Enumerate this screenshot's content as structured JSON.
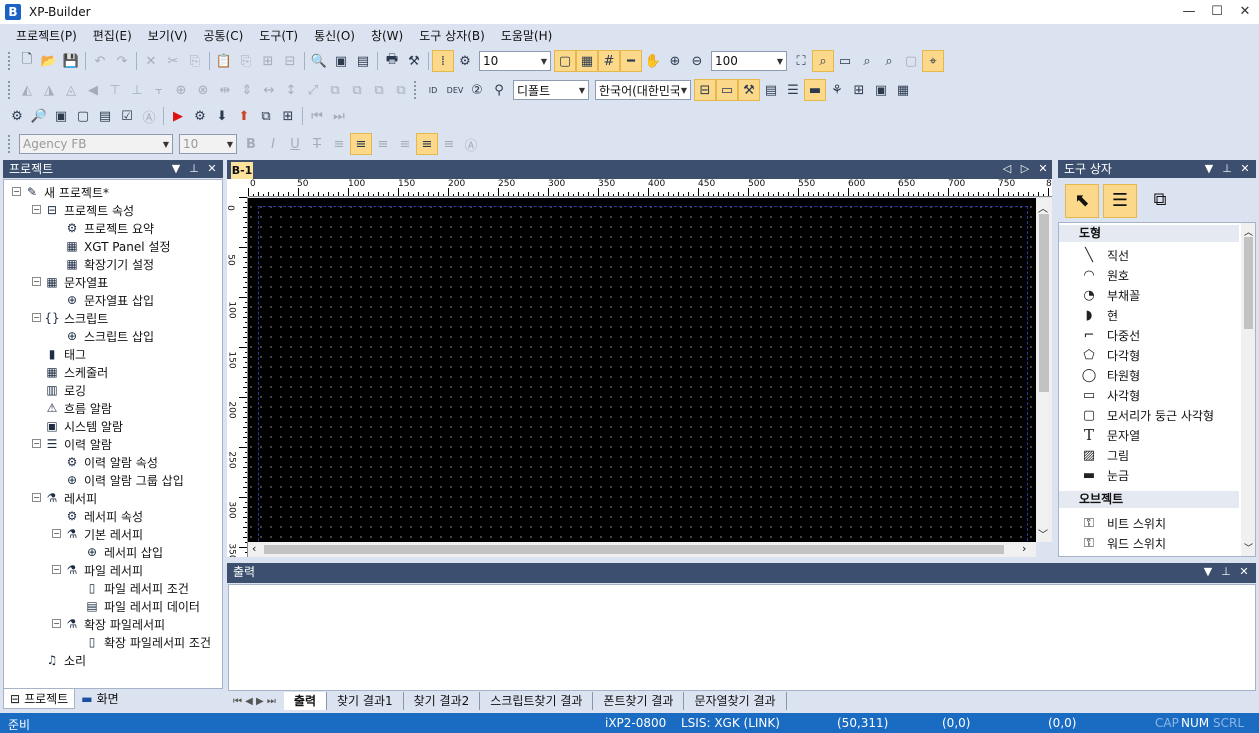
{
  "app": {
    "title": "XP-Builder",
    "logo_letter": "B"
  },
  "window": {
    "min": "—",
    "max": "☐",
    "close": "✕"
  },
  "menu": [
    "프로젝트(P)",
    "편집(E)",
    "보기(V)",
    "공통(C)",
    "도구(T)",
    "통신(O)",
    "창(W)",
    "도구 상자(B)",
    "도움말(H)"
  ],
  "toolbar": {
    "grid_size": "10",
    "zoom": "100",
    "font_name": "Agency FB",
    "font_size": "10",
    "default_combo": "디폴트",
    "language": "한국어(대한민국"
  },
  "project_panel": {
    "title": "프로젝트",
    "tree": [
      "새 프로젝트*",
      "프로젝트 속성",
      "프로젝트 요약",
      "XGT Panel 설정",
      "확장기기 설정",
      "문자열표",
      "문자열표 삽입",
      "스크립트",
      "스크립트 삽입",
      "태그",
      "스케줄러",
      "로깅",
      "흐름 알람",
      "시스템 알람",
      "이력 알람",
      "이력 알람 속성",
      "이력 알람 그룹 삽입",
      "레서피",
      "레서피 속성",
      "기본 레서피",
      "레서피 삽입",
      "파일 레서피",
      "파일 레서피 조건",
      "파일 레서피 데이터",
      "확장 파일레서피",
      "확장 파일레서피 조건",
      "소리"
    ],
    "tabs": [
      "프로젝트",
      "화면"
    ]
  },
  "document": {
    "tab": "B-1",
    "hruler": [
      "0",
      "50",
      "100",
      "150",
      "200",
      "250",
      "300",
      "350",
      "400",
      "450",
      "500",
      "550",
      "600",
      "650",
      "700",
      "750",
      "8"
    ],
    "vruler": [
      "0",
      "50",
      "100",
      "150",
      "200",
      "250",
      "300",
      "350"
    ]
  },
  "toolbox": {
    "title": "도구 상자",
    "section_shapes": "도형",
    "shapes": [
      "직선",
      "원호",
      "부채꼴",
      "현",
      "다중선",
      "다각형",
      "타원형",
      "사각형",
      "모서리가 둥근 사각형",
      "문자열",
      "그림",
      "눈금"
    ],
    "section_objects": "오브젝트",
    "objects": [
      "비트 스위치",
      "워드 스위치"
    ]
  },
  "output": {
    "title": "출력",
    "tabs": [
      "출력",
      "찾기 결과1",
      "찾기 결과2",
      "스크립트찾기 결과",
      "폰트찾기 결과",
      "문자열찾기 결과"
    ]
  },
  "status": {
    "ready": "준비",
    "device": "iXP2-0800",
    "link": "LSIS: XGK (LINK)",
    "pos": "(50,311)",
    "c1": "(0,0)",
    "c2": "(0,0)",
    "cap": "CAP",
    "num": "NUM",
    "scrl": "SCRL"
  }
}
